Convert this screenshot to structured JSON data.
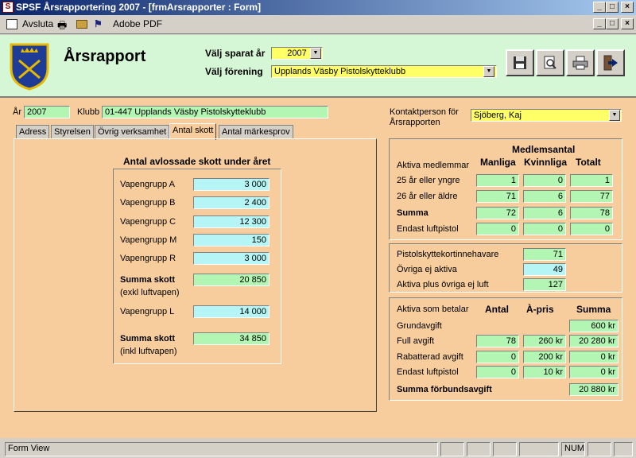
{
  "window": {
    "title": "SPSF Årsrapportering 2007 - [frmArsrapporter : Form]"
  },
  "menubar": {
    "close_label": "Avsluta",
    "adobe_label": "Adobe PDF"
  },
  "header": {
    "title": "Årsrapport",
    "year_label": "Välj sparat år",
    "year_value": "2007",
    "club_label": "Välj förening",
    "club_value": "Upplands Väsby Pistolskytteklubb"
  },
  "info": {
    "year_label": "År",
    "year_value": "2007",
    "club_label": "Klubb",
    "club_value": "01-447 Upplands Väsby Pistolskytteklubb"
  },
  "tabs": [
    "Adress",
    "Styrelsen",
    "Övrig verksamhet",
    "Antal skott",
    "Antal märkesprov"
  ],
  "shots": {
    "title": "Antal avlossade skott under året",
    "groups": [
      {
        "label": "Vapengrupp A",
        "value": "3 000"
      },
      {
        "label": "Vapengrupp B",
        "value": "2 400"
      },
      {
        "label": "Vapengrupp C",
        "value": "12 300"
      },
      {
        "label": "Vapengrupp M",
        "value": "150"
      },
      {
        "label": "Vapengrupp R",
        "value": "3 000"
      }
    ],
    "sum_excl_label": "Summa skott",
    "sum_excl_sub": "(exkl luftvapen)",
    "sum_excl_value": "20 850",
    "group_l_label": "Vapengrupp L",
    "group_l_value": "14 000",
    "sum_incl_label": "Summa skott",
    "sum_incl_sub": "(inkl luftvapen)",
    "sum_incl_value": "34 850"
  },
  "contact": {
    "label_line1": "Kontaktperson för",
    "label_line2": "Årsrapporten",
    "value": "Sjöberg, Kaj"
  },
  "members": {
    "heading": "Medlemsantal",
    "row_heading": "Aktiva medlemmar",
    "columns": [
      "Manliga",
      "Kvinnliga",
      "Totalt"
    ],
    "rows": [
      {
        "label": "25 år eller yngre",
        "values": [
          "1",
          "0",
          "1"
        ],
        "bold": false
      },
      {
        "label": "26 år eller äldre",
        "values": [
          "71",
          "6",
          "77"
        ],
        "bold": false
      },
      {
        "label": "Summa",
        "values": [
          "72",
          "6",
          "78"
        ],
        "bold": true
      },
      {
        "label": "Endast luftpistol",
        "values": [
          "0",
          "0",
          "0"
        ],
        "bold": false
      }
    ]
  },
  "cards": {
    "holders_label": "Pistolskyttekortinnehavare",
    "holders_value": "71",
    "inactive_label": "Övriga ej aktiva",
    "inactive_value": "49",
    "total_label": "Aktiva plus övriga ej luft",
    "total_value": "127"
  },
  "fees": {
    "heading": "Aktiva som betalar",
    "columns": [
      "Antal",
      "À-pris",
      "Summa"
    ],
    "base_label": "Grundavgift",
    "base_sum": "600 kr",
    "rows": [
      {
        "label": "Full avgift",
        "count": "78",
        "price": "260 kr",
        "sum": "20 280 kr"
      },
      {
        "label": "Rabatterad avgift",
        "count": "0",
        "price": "200 kr",
        "sum": "0 kr"
      },
      {
        "label": "Endast luftpistol",
        "count": "0",
        "price": "10 kr",
        "sum": "0 kr"
      }
    ],
    "total_label": "Summa förbundsavgift",
    "total_value": "20 880 kr"
  },
  "statusbar": {
    "view": "Form View",
    "num": "NUM"
  }
}
